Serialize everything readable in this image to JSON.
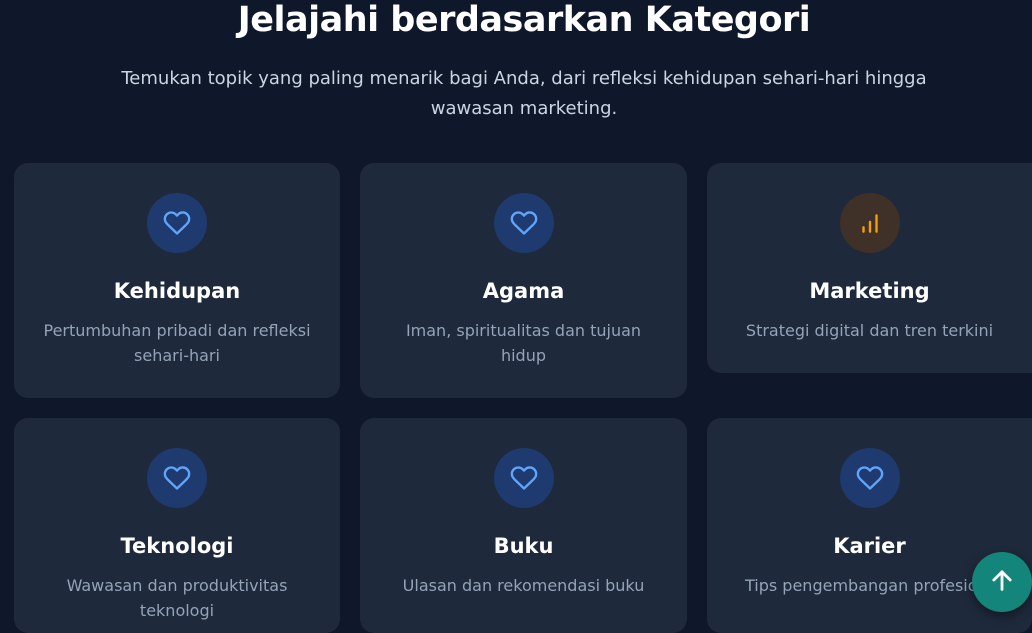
{
  "section": {
    "title": "Jelajahi berdasarkan Kategori",
    "subtitle": "Temukan topik yang paling menarik bagi Anda, dari refleksi kehidupan sehari-hari hingga wawasan marketing."
  },
  "categories": [
    {
      "name": "Kehidupan",
      "description": "Pertumbuhan pribadi dan refleksi sehari-hari",
      "icon": "heart-icon"
    },
    {
      "name": "Agama",
      "description": "Iman, spiritualitas dan tujuan hidup",
      "icon": "heart-icon"
    },
    {
      "name": "Marketing",
      "description": "Strategi digital dan tren terkini",
      "icon": "bar-chart-icon"
    },
    {
      "name": "Teknologi",
      "description": "Wawasan dan produktivitas teknologi",
      "icon": "heart-icon"
    },
    {
      "name": "Buku",
      "description": "Ulasan dan rekomendasi buku",
      "icon": "heart-icon"
    },
    {
      "name": "Karier",
      "description": "Tips pengembangan profesional",
      "icon": "heart-icon"
    }
  ],
  "scroll_top": {
    "icon": "arrow-up-icon"
  },
  "colors": {
    "background": "#0f172a",
    "card": "#1e293b",
    "heart_accent": "#60a5fa",
    "chart_accent": "#f59e0b",
    "scroll_button": "#14857a"
  }
}
